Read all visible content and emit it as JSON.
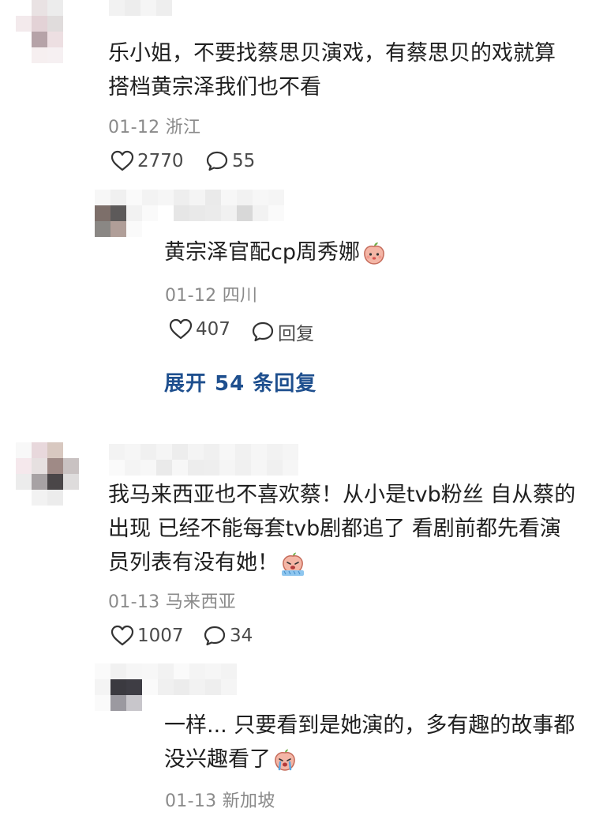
{
  "comments": [
    {
      "text": "乐小姐，不要找蔡思贝演戏，有蔡思贝的戏就算搭档黄宗泽我们也不看",
      "line1": "乐小姐，不要找蔡思贝演戏，有蔡思贝的戏就算",
      "line2": "搭档黄宗泽我们也不看",
      "date": "01-12",
      "location": "浙江",
      "likes": "2770",
      "replies": "55"
    },
    {
      "line1": "我马来西亚也不喜欢蔡！从小是tvb粉丝 自从蔡的",
      "line2": "出现 已经不能每套tvb剧都追了 看剧前都先看演",
      "line3": "员列表有没有她！",
      "date": "01-13",
      "location": "马来西亚",
      "likes": "1007",
      "replies": "34"
    }
  ],
  "replies": [
    {
      "text": "黄宗泽官配cp周秀娜",
      "date": "01-12",
      "location": "四川",
      "likes": "407",
      "reply_label": "回复"
    },
    {
      "line1": "一样... 只要看到是她演的，多有趣的故事都",
      "line2": "没兴趣看了",
      "date": "01-13",
      "location": "新加坡"
    }
  ],
  "expand_label": "展开 54 条回复",
  "icons": [
    "heart-icon",
    "comment-bubble-icon",
    "peach-emoji",
    "crying-emoji"
  ],
  "colors": {
    "link": "#1e4f8e",
    "meta": "#8a8a8a",
    "text": "#1f1f1f"
  }
}
